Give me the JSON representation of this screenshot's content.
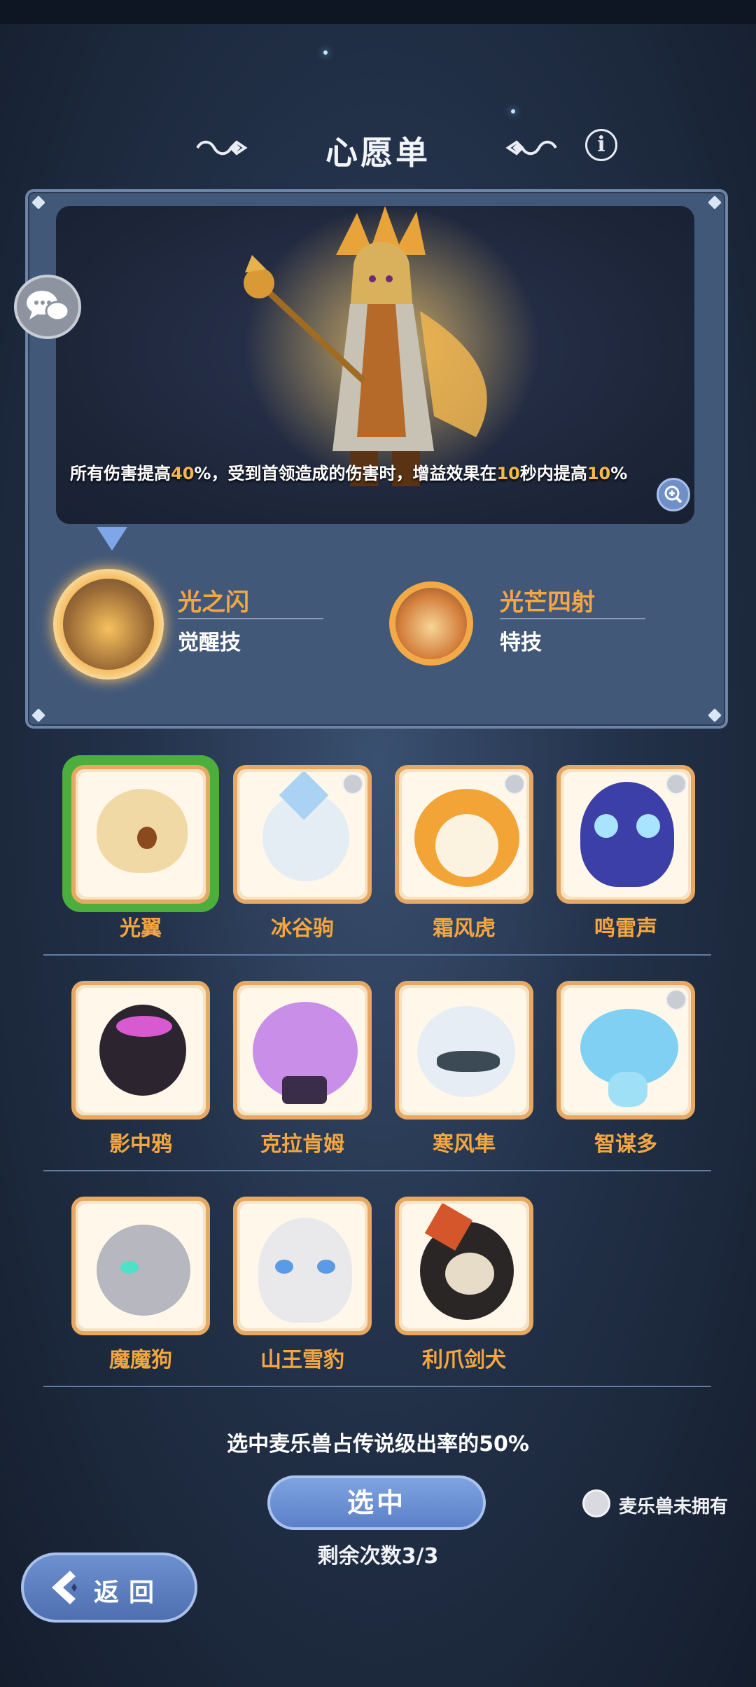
{
  "header": {
    "title": "心愿单",
    "info_icon": "i"
  },
  "featured": {
    "description_parts": [
      "所有伤害提高",
      "40",
      "%，受到首领造成的伤害时，增益效果在",
      "10",
      "秒内提高",
      "10",
      "%"
    ],
    "skills": [
      {
        "name": "光之闪",
        "type": "觉醒技"
      },
      {
        "name": "光芒四射",
        "type": "特技"
      }
    ]
  },
  "pets": [
    {
      "name": "光翼",
      "selected": true,
      "owned_badge": true
    },
    {
      "name": "冰谷驹",
      "selected": false,
      "owned_badge": true
    },
    {
      "name": "霜风虎",
      "selected": false,
      "owned_badge": true
    },
    {
      "name": "鸣雷声",
      "selected": false,
      "owned_badge": true
    },
    {
      "name": "影中鸦",
      "selected": false,
      "owned_badge": false
    },
    {
      "name": "克拉肯姆",
      "selected": false,
      "owned_badge": false
    },
    {
      "name": "寒风隼",
      "selected": false,
      "owned_badge": false
    },
    {
      "name": "智谋多",
      "selected": false,
      "owned_badge": true
    },
    {
      "name": "魔魔狗",
      "selected": false,
      "owned_badge": false
    },
    {
      "name": "山王雪豹",
      "selected": false,
      "owned_badge": false
    },
    {
      "name": "利爪剑犬",
      "selected": false,
      "owned_badge": false
    }
  ],
  "footer": {
    "rate_text": "选中麦乐兽占传说级出率的50%",
    "select_label": "选中",
    "remaining_text": "剩余次数3/3",
    "legend_text": "麦乐兽未拥有",
    "back_label": "返回"
  },
  "colors": {
    "accent_orange": "#f4a640",
    "highlight": "#f6b84a",
    "selected_green": "#4cae3c",
    "button_blue": "#5b80c8",
    "panel": "#425879"
  },
  "icons": {
    "info": "info-icon",
    "zoom": "zoom-in-icon",
    "chat": "chat-bubbles-icon",
    "back": "back-arrow-icon",
    "owned": "bag-icon"
  }
}
